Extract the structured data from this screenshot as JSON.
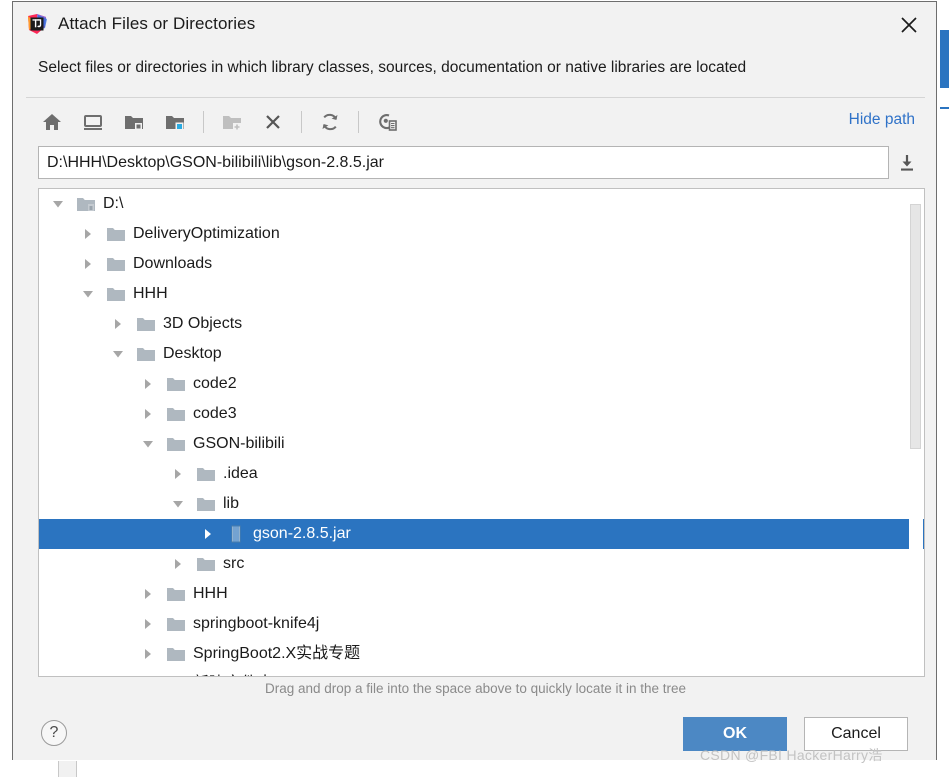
{
  "dialog": {
    "title": "Attach Files or Directories",
    "app_icon": "intellij-idea-logo",
    "close_icon": "close-icon",
    "description": "Select files or directories in which library classes, sources, documentation or native libraries are located"
  },
  "toolbar": {
    "buttons": [
      {
        "name": "home-icon",
        "title": "Home",
        "enabled": true
      },
      {
        "name": "desktop-icon",
        "title": "Desktop",
        "enabled": true
      },
      {
        "name": "project-folder-icon",
        "title": "Project Directory",
        "enabled": true
      },
      {
        "name": "module-folder-icon",
        "title": "Module Directory",
        "enabled": true
      },
      {
        "name": "new-folder-icon",
        "title": "New Folder",
        "enabled": false
      },
      {
        "name": "delete-icon",
        "title": "Delete",
        "enabled": true
      },
      {
        "name": "refresh-icon",
        "title": "Refresh",
        "enabled": true
      },
      {
        "name": "show-hidden-files-icon",
        "title": "Show Hidden Files",
        "enabled": true
      }
    ],
    "hide_path_label": "Hide path"
  },
  "path": {
    "value": "D:\\HHH\\Desktop\\GSON-bilibili\\lib\\gson-2.8.5.jar",
    "placeholder": "",
    "download_icon": "download-icon"
  },
  "tree": {
    "rows": [
      {
        "depth": 0,
        "state": "expanded",
        "icon": "drive-folder-icon",
        "label": "D:\\",
        "selected": false
      },
      {
        "depth": 1,
        "state": "collapsed",
        "icon": "folder-icon",
        "label": "DeliveryOptimization",
        "selected": false
      },
      {
        "depth": 1,
        "state": "collapsed",
        "icon": "folder-icon",
        "label": "Downloads",
        "selected": false
      },
      {
        "depth": 1,
        "state": "expanded",
        "icon": "folder-icon",
        "label": "HHH",
        "selected": false
      },
      {
        "depth": 2,
        "state": "collapsed",
        "icon": "folder-icon",
        "label": "3D Objects",
        "selected": false
      },
      {
        "depth": 2,
        "state": "expanded",
        "icon": "folder-icon",
        "label": "Desktop",
        "selected": false
      },
      {
        "depth": 3,
        "state": "collapsed",
        "icon": "folder-icon",
        "label": "code2",
        "selected": false
      },
      {
        "depth": 3,
        "state": "collapsed",
        "icon": "folder-icon",
        "label": "code3",
        "selected": false
      },
      {
        "depth": 3,
        "state": "expanded",
        "icon": "folder-icon",
        "label": "GSON-bilibili",
        "selected": false
      },
      {
        "depth": 4,
        "state": "collapsed",
        "icon": "folder-icon",
        "label": ".idea",
        "selected": false
      },
      {
        "depth": 4,
        "state": "expanded",
        "icon": "folder-icon",
        "label": "lib",
        "selected": false
      },
      {
        "depth": 5,
        "state": "collapsed",
        "icon": "jar-file-icon",
        "label": "gson-2.8.5.jar",
        "selected": true
      },
      {
        "depth": 4,
        "state": "collapsed",
        "icon": "folder-icon",
        "label": "src",
        "selected": false
      },
      {
        "depth": 3,
        "state": "collapsed",
        "icon": "folder-icon",
        "label": "HHH",
        "selected": false
      },
      {
        "depth": 3,
        "state": "collapsed",
        "icon": "folder-icon",
        "label": "springboot-knife4j",
        "selected": false
      },
      {
        "depth": 3,
        "state": "collapsed",
        "icon": "folder-icon",
        "label": "SpringBoot2.X实战专题",
        "selected": false
      },
      {
        "depth": 3,
        "state": "collapsed",
        "icon": "folder-icon",
        "label": "新建文件夹",
        "selected": false
      }
    ],
    "selection_color": "#2b74c0"
  },
  "hint": {
    "text": "Drag and drop a file into the space above to quickly locate it in the tree"
  },
  "footer": {
    "help_label": "?",
    "ok_label": "OK",
    "cancel_label": "Cancel",
    "ok_color": "#4c88c4"
  },
  "watermark": {
    "text": "CSDN @FBI HackerHarry浩"
  }
}
